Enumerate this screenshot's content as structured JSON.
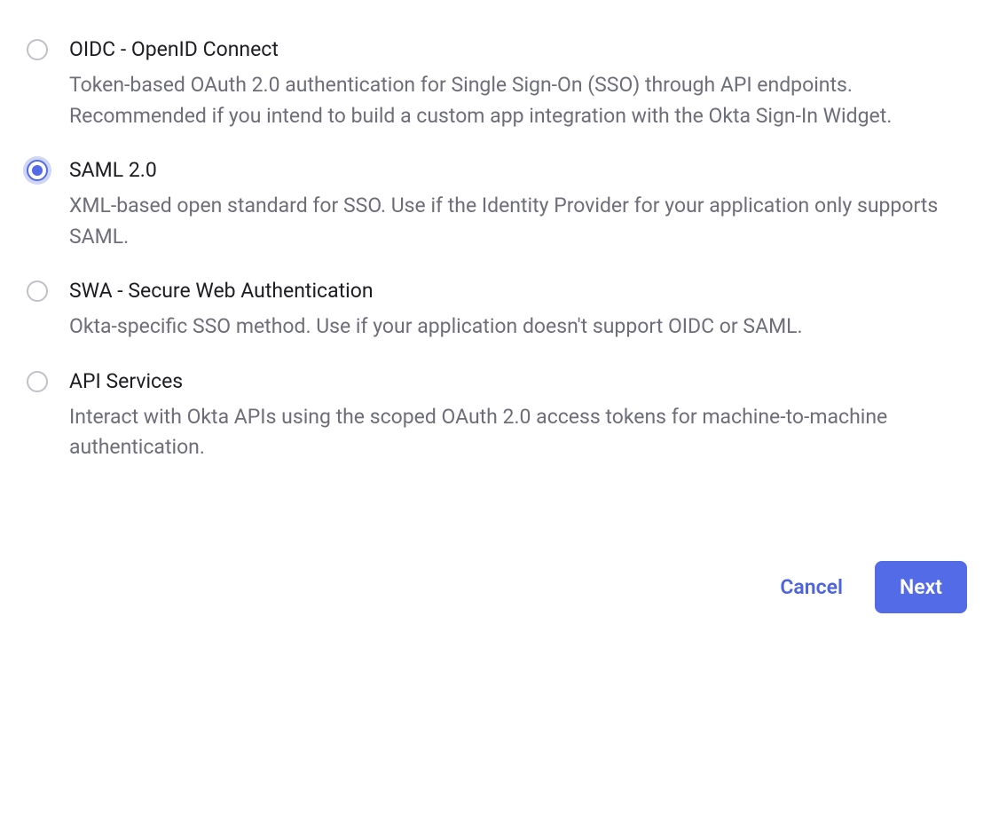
{
  "options": [
    {
      "id": "oidc",
      "title": "OIDC - OpenID Connect",
      "description": "Token-based OAuth 2.0 authentication for Single Sign-On (SSO) through API endpoints. Recommended if you intend to build a custom app integration with the Okta Sign-In Widget.",
      "selected": false
    },
    {
      "id": "saml",
      "title": "SAML 2.0",
      "description": "XML-based open standard for SSO. Use if the Identity Provider for your application only supports SAML.",
      "selected": true
    },
    {
      "id": "swa",
      "title": "SWA - Secure Web Authentication",
      "description": "Okta-specific SSO method. Use if your application doesn't support OIDC or SAML.",
      "selected": false
    },
    {
      "id": "api",
      "title": "API Services",
      "description": "Interact with Okta APIs using the scoped OAuth 2.0 access tokens for machine-to-machine authentication.",
      "selected": false
    }
  ],
  "footer": {
    "cancel_label": "Cancel",
    "next_label": "Next"
  }
}
